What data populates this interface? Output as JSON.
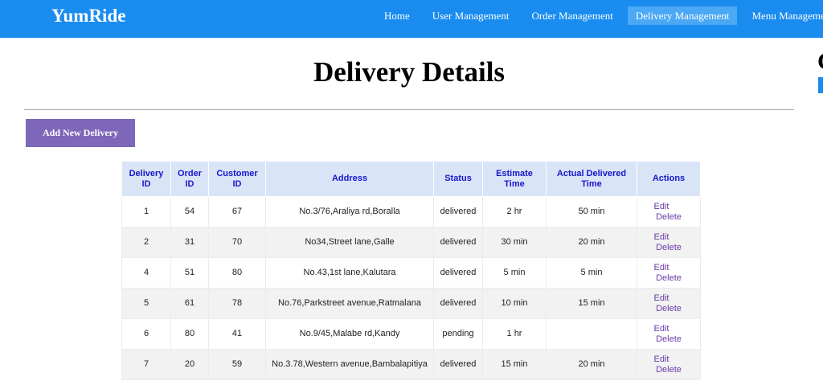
{
  "navbar": {
    "brand": "YumRide",
    "links": [
      "Home",
      "User Management",
      "Order Management",
      "Delivery Management",
      "Menu Management"
    ]
  },
  "page": {
    "title": "Delivery Details",
    "edge_letter": "C",
    "add_button": "Add New Delivery"
  },
  "table": {
    "headers": [
      "Delivery ID",
      "Order ID",
      "Customer ID",
      "Address",
      "Status",
      "Estimate Time",
      "Actual Delivered Time",
      "Actions"
    ],
    "rows": [
      {
        "delivery_id": "1",
        "order_id": "54",
        "customer_id": "67",
        "address": "No.3/76,Araliya rd,Boralla",
        "status": "delivered",
        "estimate": "2 hr",
        "actual": "50 min"
      },
      {
        "delivery_id": "2",
        "order_id": "31",
        "customer_id": "70",
        "address": "No34,Street lane,Galle",
        "status": "delivered",
        "estimate": "30 min",
        "actual": "20 min"
      },
      {
        "delivery_id": "4",
        "order_id": "51",
        "customer_id": "80",
        "address": "No.43,1st lane,Kalutara",
        "status": "delivered",
        "estimate": "5 min",
        "actual": "5 min"
      },
      {
        "delivery_id": "5",
        "order_id": "61",
        "customer_id": "78",
        "address": "No.76,Parkstreet avenue,Ratmalana",
        "status": "delivered",
        "estimate": "10 min",
        "actual": "15 min"
      },
      {
        "delivery_id": "6",
        "order_id": "80",
        "customer_id": "41",
        "address": "No.9/45,Malabe rd,Kandy",
        "status": "pending",
        "estimate": "1 hr",
        "actual": ""
      },
      {
        "delivery_id": "7",
        "order_id": "20",
        "customer_id": "59",
        "address": "No.3.78,Western avenue,Bambalapitiya",
        "status": "delivered",
        "estimate": "15 min",
        "actual": "20 min"
      }
    ],
    "edit_label": "Edit",
    "delete_label": "Delete"
  }
}
